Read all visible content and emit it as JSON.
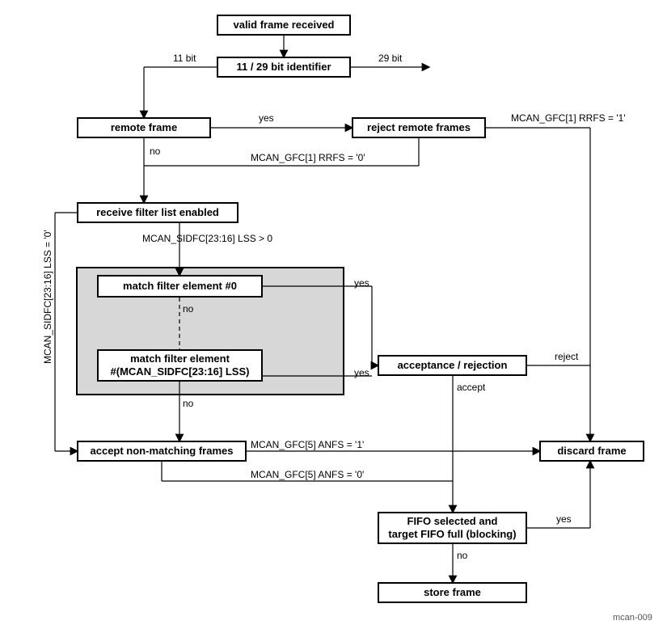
{
  "nodes": {
    "valid_frame": "valid frame received",
    "identifier": "11 / 29 bit identifier",
    "remote_frame": "remote frame",
    "reject_remote": "reject remote frames",
    "filter_enabled": "receive filter list enabled",
    "match0": "match filter element #0",
    "matchN": "match filter element\n#(MCAN_SIDFC[23:16] LSS)",
    "accept_reject": "acceptance / rejection",
    "accept_nonmatch": "accept non-matching frames",
    "discard": "discard frame",
    "fifo": "FIFO selected and\ntarget FIFO full (blocking)",
    "store": "store frame"
  },
  "labels": {
    "l11": "11 bit",
    "l29": "29 bit",
    "yes": "yes",
    "no": "no",
    "reject": "reject",
    "accept": "accept",
    "rrfs1": "MCAN_GFC[1] RRFS = '1'",
    "rrfs0": "MCAN_GFC[1] RRFS = '0'",
    "lss_gt0": "MCAN_SIDFC[23:16] LSS > 0",
    "lss_eq0": "MCAN_SIDFC[23:16] LSS = '0'",
    "anfs1": "MCAN_GFC[5] ANFS = '1'",
    "anfs0": "MCAN_GFC[5] ANFS = '0'"
  },
  "footer": "mcan-009"
}
